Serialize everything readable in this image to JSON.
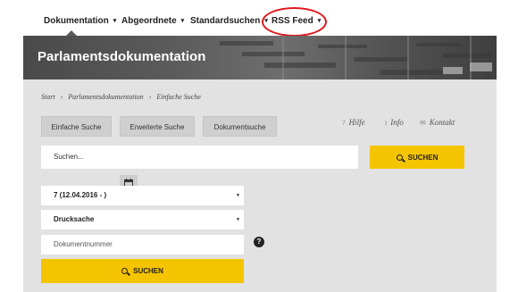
{
  "nav": {
    "items": [
      {
        "label": "Dokumentation"
      },
      {
        "label": "Abgeordnete"
      },
      {
        "label": "Standardsuchen"
      },
      {
        "label": "RSS Feed"
      }
    ],
    "caret": "▾"
  },
  "banner": {
    "title": "Parlamentsdokumentation"
  },
  "breadcrumb": [
    "Start",
    "›",
    "Parlamentsdokumentation",
    "›",
    "Einfache Suche"
  ],
  "tabs": [
    "Einfache Suche",
    "Erweiterte Suche",
    "Dokumentsuche"
  ],
  "utility_links": [
    {
      "label": "Hilfe",
      "icon": "?"
    },
    {
      "label": "Info",
      "icon": "i"
    },
    {
      "label": "Kontakt",
      "icon": "✉"
    }
  ],
  "search": {
    "placeholder": "Suchen...",
    "button_label": "SUCHEN"
  },
  "filters": {
    "period_value": "7 (12.04.2016 - )",
    "doctype_value": "Drucksache",
    "docnumber_placeholder": "Dokumentnummer",
    "help_icon": "?",
    "submit_label": "SUCHEN",
    "select_arrow": "▼"
  },
  "colors": {
    "accent": "#f5c400",
    "banner": "#5a5a5a",
    "panel": "#e2e2e2",
    "annotation": "#e0161b"
  }
}
